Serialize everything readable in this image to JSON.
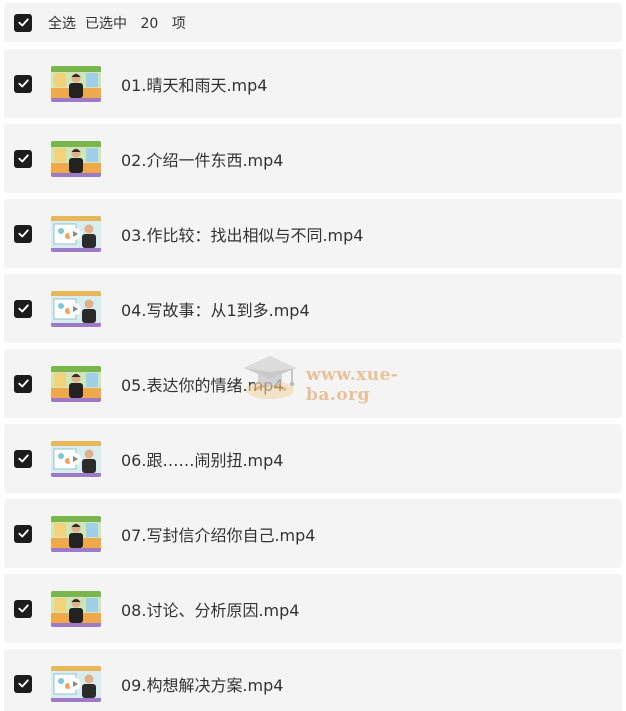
{
  "header": {
    "select_all": "全选",
    "selected_prefix": "已选中",
    "selected_count": "20",
    "selected_suffix": "项"
  },
  "files": [
    {
      "name": "01.晴天和雨天.mp4",
      "thumb": "teacher"
    },
    {
      "name": "02.介绍一件东西.mp4",
      "thumb": "teacher"
    },
    {
      "name": "03.作比较：找出相似与不同.mp4",
      "thumb": "slide"
    },
    {
      "name": "04.写故事：从1到多.mp4",
      "thumb": "slide"
    },
    {
      "name": "05.表达你的情绪.mp4",
      "thumb": "teacher"
    },
    {
      "name": "06.跟……闹别扭.mp4",
      "thumb": "slide"
    },
    {
      "name": "07.写封信介绍你自己.mp4",
      "thumb": "teacher"
    },
    {
      "name": "08.讨论、分析原因.mp4",
      "thumb": "teacher"
    },
    {
      "name": "09.构想解决方案.mp4",
      "thumb": "slide"
    }
  ],
  "watermark": "www.xue-ba.org",
  "colors": {
    "row_bg": "#f4f4f4",
    "checkbox": "#1c1c1c",
    "text": "#333333",
    "watermark": "#e6b17a"
  },
  "icons": {
    "checkbox": "check-icon",
    "thumbnail": "video-thumbnail",
    "watermark": "graduation-cap-icon"
  }
}
